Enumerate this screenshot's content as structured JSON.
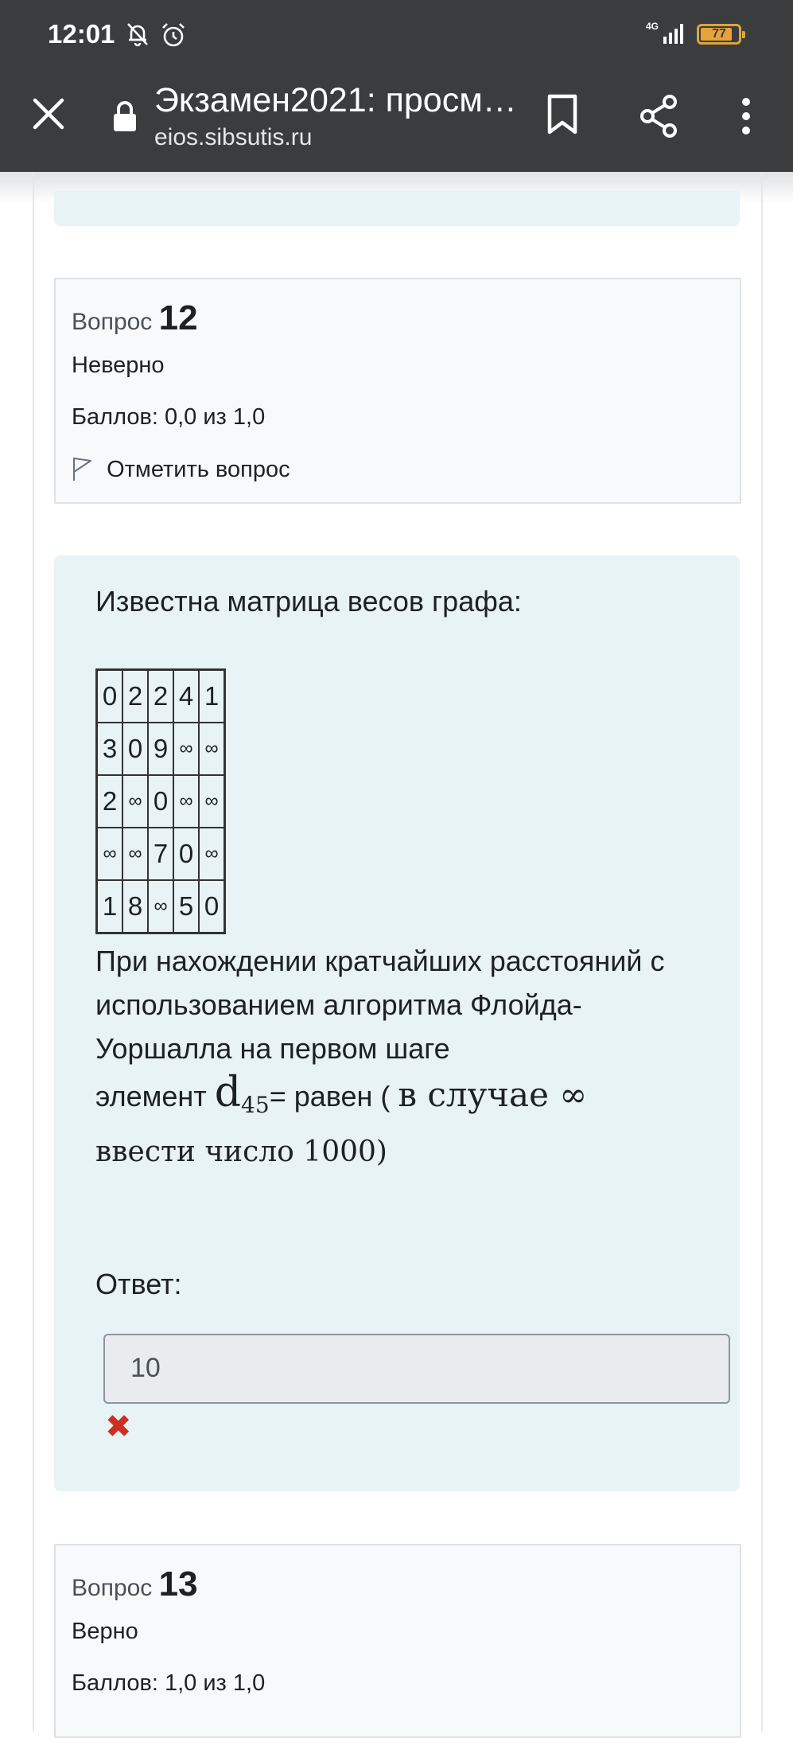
{
  "status_bar": {
    "time": "12:01",
    "network": "4G",
    "battery": "77"
  },
  "toolbar": {
    "title": "Экзамен2021: просм…",
    "url": "eios.sibsutis.ru"
  },
  "q12": {
    "label": "Вопрос",
    "number": "12",
    "state": "Неверно",
    "grade": "Баллов: 0,0 из 1,0",
    "flag": "Отметить вопрос"
  },
  "question": {
    "intro": "Известна матрица весов графа:",
    "matrix": [
      [
        "0",
        "2",
        "2",
        "4",
        "1"
      ],
      [
        "3",
        "0",
        "9",
        "∞",
        "∞"
      ],
      [
        "2",
        "∞",
        "0",
        "∞",
        "∞"
      ],
      [
        "∞",
        "∞",
        "7",
        "0",
        "∞"
      ],
      [
        "1",
        "8",
        "∞",
        "5",
        "0"
      ]
    ],
    "line1": "При нахождении кратчайших расстояний с",
    "line2": "использованием алгоритма Флойда-",
    "line3": "Уоршалла на первом шаге",
    "line4_a": "элемент ",
    "line4_d": "d",
    "line4_sub": "45",
    "line4_b": "= равен ( ",
    "line4_c": "в случае ∞",
    "line5": "ввести число 1000)",
    "answer_label": "Ответ:",
    "answer_value": "10"
  },
  "q13": {
    "label": "Вопрос",
    "number": "13",
    "state": "Верно",
    "grade": "Баллов: 1,0 из 1,0"
  }
}
